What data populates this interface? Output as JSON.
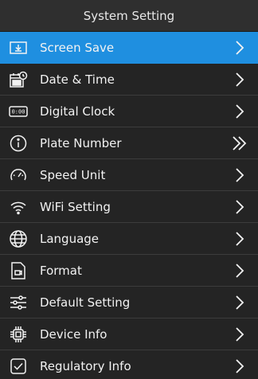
{
  "header": {
    "title": "System Setting"
  },
  "menu": {
    "items": [
      {
        "label": "Screen Save",
        "icon": "screen-save-icon",
        "selected": true
      },
      {
        "label": "Date & Time",
        "icon": "calendar-clock-icon"
      },
      {
        "label": "Digital Clock",
        "icon": "digital-clock-icon",
        "icon_text": "0:00"
      },
      {
        "label": "Plate Number",
        "icon": "info-circle-icon",
        "chevron": "double"
      },
      {
        "label": "Speed Unit",
        "icon": "speedometer-icon"
      },
      {
        "label": "WiFi Setting",
        "icon": "wifi-icon"
      },
      {
        "label": "Language",
        "icon": "globe-icon"
      },
      {
        "label": "Format",
        "icon": "sd-card-icon"
      },
      {
        "label": "Default Setting",
        "icon": "sliders-icon"
      },
      {
        "label": "Device Info",
        "icon": "chip-icon"
      },
      {
        "label": "Regulatory Info",
        "icon": "checkbox-icon"
      }
    ]
  },
  "colors": {
    "accent": "#1f8fe0",
    "background": "#1b1b1b",
    "row": "#242424"
  }
}
